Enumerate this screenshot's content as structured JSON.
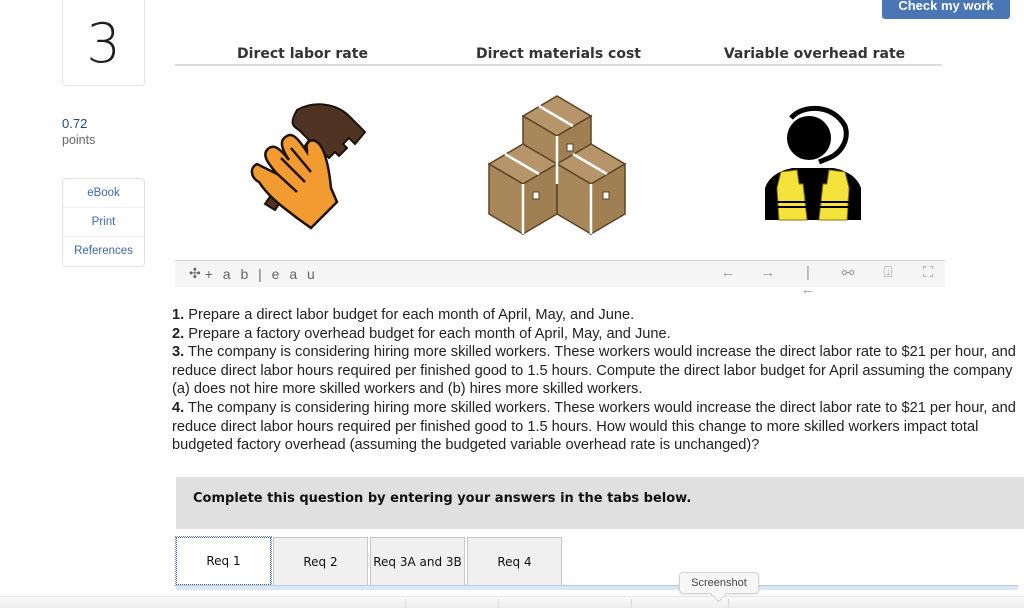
{
  "question": {
    "number": "3",
    "points_value": "0.72",
    "points_label": "points"
  },
  "resources": [
    {
      "label": "eBook"
    },
    {
      "label": "Print"
    },
    {
      "label": "References"
    }
  ],
  "header": {
    "check_my_work": "Check my work"
  },
  "viz": {
    "columns": [
      {
        "title": "Direct labor rate",
        "icon": "hand-hammer-icon"
      },
      {
        "title": "Direct materials cost",
        "icon": "boxes-icon"
      },
      {
        "title": "Variable overhead rate",
        "icon": "worker-vest-icon"
      }
    ],
    "toolbar": {
      "logo_text": "+ a b | e a u",
      "icons": [
        "undo-icon",
        "redo-icon",
        "revert-icon",
        "share-icon",
        "download-icon",
        "fullscreen-icon"
      ]
    },
    "colors": {
      "glove": "#f29b30",
      "hammer": "#4f3322",
      "box": "#a8875a",
      "vest": "#f5e23a"
    }
  },
  "requirements": [
    {
      "num": "1.",
      "text": " Prepare a direct labor budget for each month of April, May, and June."
    },
    {
      "num": "2.",
      "text": " Prepare a factory overhead budget for each month of April, May, and June."
    },
    {
      "num": "3.",
      "text": " The company is considering hiring more skilled workers. These workers would increase the direct labor rate to $21 per hour, and reduce direct labor hours required per finished good to 1.5 hours. Compute the direct labor budget for April assuming the company (a) does not hire more skilled workers and (b) hires more skilled workers."
    },
    {
      "num": "4.",
      "text": " The company is considering hiring more skilled workers. These workers would increase the direct labor rate to $21 per hour, and reduce direct labor hours required per finished good to 1.5 hours. How would this change to more skilled workers impact total budgeted factory overhead (assuming the budgeted variable overhead rate is unchanged)?"
    }
  ],
  "instructions": "Complete this question by entering your answers in the tabs below.",
  "tabs": [
    {
      "label": "Req 1",
      "active": true
    },
    {
      "label": "Req 2",
      "active": false
    },
    {
      "label": "Req 3A and 3B",
      "active": false
    },
    {
      "label": "Req 4",
      "active": false
    }
  ],
  "tooltip": "Screenshot"
}
